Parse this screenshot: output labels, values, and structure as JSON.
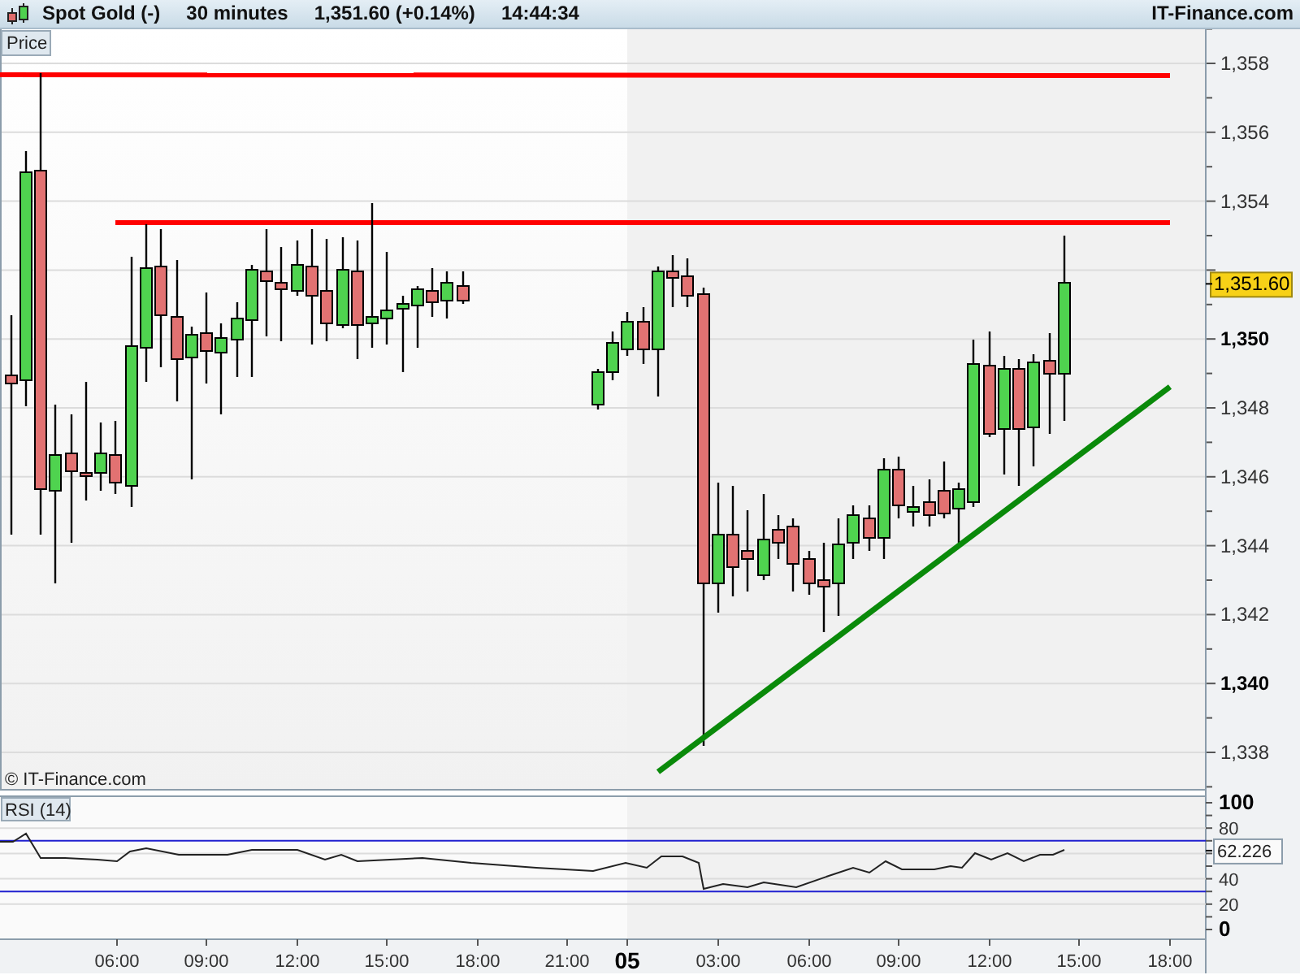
{
  "header": {
    "title": "Spot Gold (-)",
    "interval": "30 minutes",
    "quote": "1,351.60 (+0.14%)",
    "time": "14:44:34",
    "brand": "IT-Finance.com"
  },
  "price_panel": {
    "label": "Price",
    "copyright": "© IT-Finance.com",
    "current_price": "1,351.60",
    "y_axis": [
      {
        "label": "1,358",
        "bold": false
      },
      {
        "label": "1,356",
        "bold": false
      },
      {
        "label": "1,354",
        "bold": false
      },
      {
        "label": "1,350",
        "bold": true
      },
      {
        "label": "1,348",
        "bold": false
      },
      {
        "label": "1,346",
        "bold": false
      },
      {
        "label": "1,344",
        "bold": false
      },
      {
        "label": "1,342",
        "bold": false
      },
      {
        "label": "1,340",
        "bold": true
      },
      {
        "label": "1,338",
        "bold": false
      }
    ]
  },
  "rsi_panel": {
    "label": "RSI (14)",
    "current_value": "62.226",
    "y_axis": [
      {
        "label": "100",
        "bold": true
      },
      {
        "label": "80",
        "bold": false
      },
      {
        "label": "40",
        "bold": false
      },
      {
        "label": "20",
        "bold": false
      },
      {
        "label": "0",
        "bold": true
      }
    ]
  },
  "x_axis": [
    {
      "label": "06:00",
      "bold": false
    },
    {
      "label": "09:00",
      "bold": false
    },
    {
      "label": "12:00",
      "bold": false
    },
    {
      "label": "15:00",
      "bold": false
    },
    {
      "label": "18:00",
      "bold": false
    },
    {
      "label": "21:00",
      "bold": false
    },
    {
      "label": "05",
      "bold": true
    },
    {
      "label": "03:00",
      "bold": false
    },
    {
      "label": "06:00",
      "bold": false
    },
    {
      "label": "09:00",
      "bold": false
    },
    {
      "label": "12:00",
      "bold": false
    },
    {
      "label": "15:00",
      "bold": false
    },
    {
      "label": "18:00",
      "bold": false
    }
  ]
}
